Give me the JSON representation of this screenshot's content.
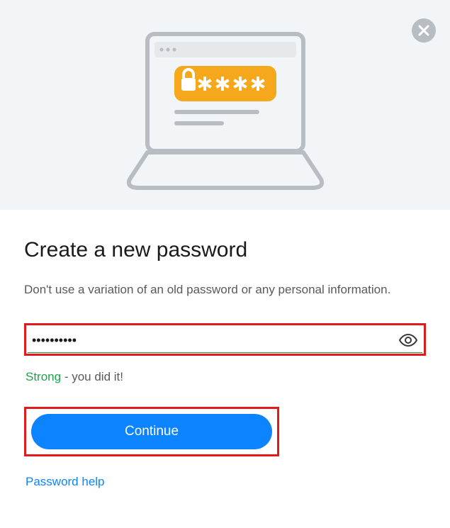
{
  "title": "Create a new password",
  "subtitle": "Don't use a variation of an old password or any personal information.",
  "password_masked": "••••••••••",
  "strength": {
    "label": "Strong",
    "suffix": " - you did it!"
  },
  "continue_label": "Continue",
  "help_link_label": "Password help"
}
